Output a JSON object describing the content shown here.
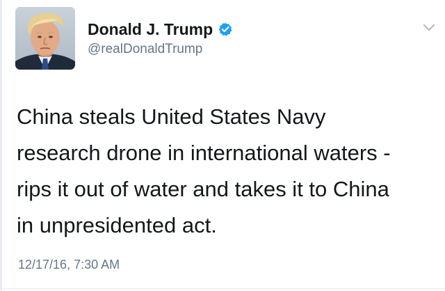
{
  "author": {
    "display_name": "Donald J. Trump",
    "handle": "@realDonaldTrump",
    "verified": true,
    "avatar": "profile-photo"
  },
  "tweet": {
    "text_lines": [
      "China steals United States Navy",
      "research drone in international waters -",
      "rips it out of water and takes it to China",
      "in unpresidented act."
    ],
    "timestamp": "12/17/16, 7:30 AM"
  },
  "icons": {
    "verified": "verified-badge-icon",
    "menu": "chevron-down-icon"
  },
  "colors": {
    "text": "#14171a",
    "secondary_text": "#657786",
    "verified_blue": "#1da1f2",
    "divider": "#e6ecf0",
    "chevron": "#aab8c2"
  }
}
